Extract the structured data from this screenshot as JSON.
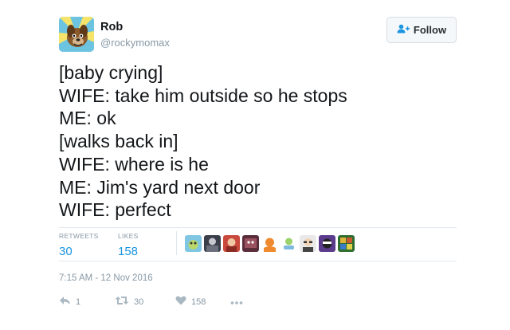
{
  "user": {
    "name": "Rob",
    "handle": "@rockymomax"
  },
  "follow_button": {
    "label": "Follow",
    "icon": "follow-user-icon"
  },
  "tweet": {
    "lines": [
      "[baby crying]",
      "WIFE: take him outside so he stops",
      "ME: ok",
      "[walks back in]",
      "WIFE: where is he",
      "ME: Jim's yard next door",
      "WIFE: perfect"
    ]
  },
  "stats": {
    "retweets_label": "RETWEETS",
    "retweets_count": "30",
    "likes_label": "LIKES",
    "likes_count": "158"
  },
  "liker_avatars": [
    "avatar-1",
    "avatar-2",
    "avatar-3",
    "avatar-4",
    "avatar-5",
    "avatar-6",
    "avatar-7",
    "avatar-8",
    "avatar-9"
  ],
  "timestamp": "7:15 AM - 12 Nov 2016",
  "actions": {
    "reply_icon": "reply-icon",
    "reply_count": "1",
    "retweet_icon": "retweet-icon",
    "retweet_count": "30",
    "like_icon": "heart-icon",
    "like_count": "158",
    "more_icon": "more-icon"
  },
  "colors": {
    "accent": "#1b95e0",
    "muted": "#8899a6",
    "text": "#14171a",
    "divider": "#e1e8ed"
  }
}
